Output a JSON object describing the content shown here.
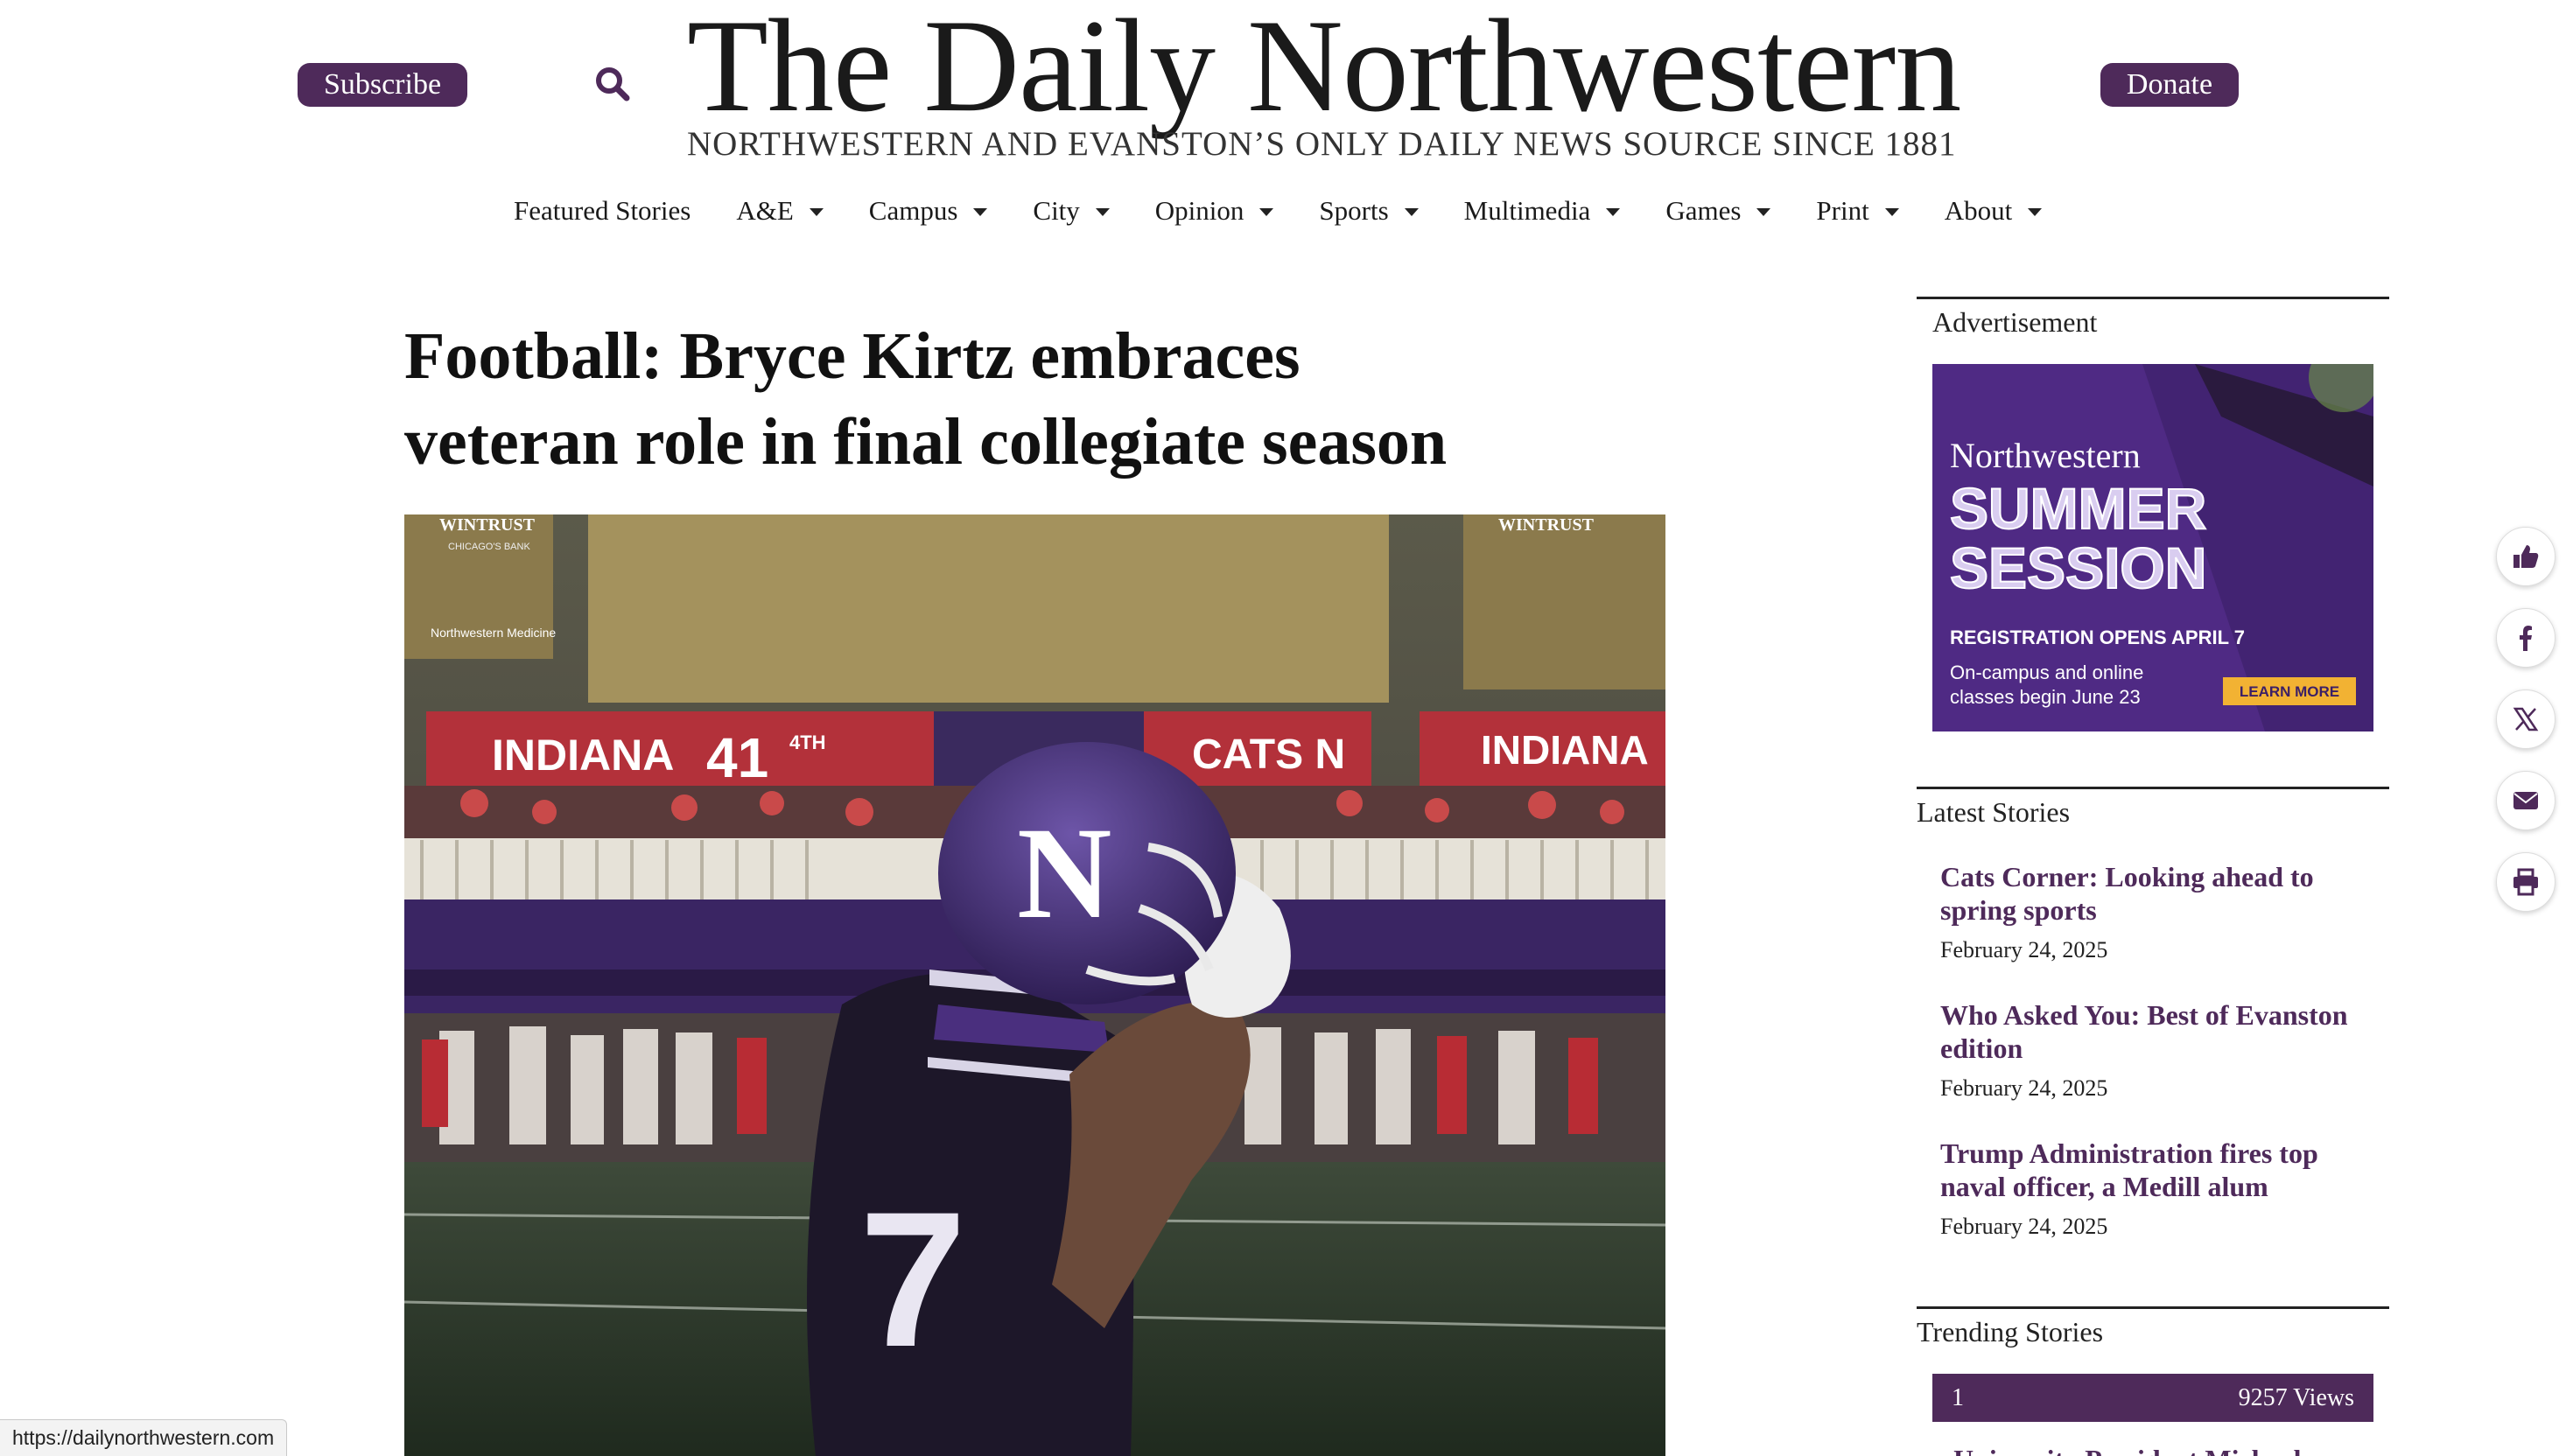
{
  "header": {
    "subscribe_label": "Subscribe",
    "donate_label": "Donate",
    "masthead": "The Daily Northwestern",
    "tagline": "NORTHWESTERN AND EVANSTON’S ONLY DAILY NEWS SOURCE SINCE 1881"
  },
  "nav": {
    "items": [
      {
        "label": "Featured Stories",
        "has_dropdown": false
      },
      {
        "label": "A&E",
        "has_dropdown": true
      },
      {
        "label": "Campus",
        "has_dropdown": true
      },
      {
        "label": "City",
        "has_dropdown": true
      },
      {
        "label": "Opinion",
        "has_dropdown": true
      },
      {
        "label": "Sports",
        "has_dropdown": true
      },
      {
        "label": "Multimedia",
        "has_dropdown": true
      },
      {
        "label": "Games",
        "has_dropdown": true
      },
      {
        "label": "Print",
        "has_dropdown": true
      },
      {
        "label": "About",
        "has_dropdown": true
      }
    ]
  },
  "article": {
    "headline_line1": "Football: Bryce Kirtz embraces",
    "headline_line2": "veteran role in final collegiate season",
    "hero": {
      "scoreboard_left_team": "INDIANA",
      "scoreboard_score": "41",
      "scoreboard_quarter": "4TH",
      "scoreboard_cats": "CATS N",
      "scoreboard_right_team": "INDIANA",
      "sponsor_left": "WINTRUST",
      "sponsor_left_sub": "CHICAGO'S BANK",
      "sponsor_nm": "Northwestern Medicine",
      "helmet_letter": "N",
      "jersey_number": "7"
    }
  },
  "sidebar": {
    "advertisement_label": "Advertisement",
    "ad": {
      "brand": "Northwestern",
      "line1": "SUMMER",
      "line2": "SESSION",
      "registration": "REGISTRATION OPENS APRIL 7",
      "detail_line1": "On-campus and online",
      "detail_line2": "classes begin June 23",
      "cta": "LEARN MORE"
    },
    "latest_heading": "Latest Stories",
    "latest": [
      {
        "title": "Cats Corner: Looking ahead to spring sports",
        "date": "February 24, 2025"
      },
      {
        "title": "Who Asked You: Best of Evanston edition",
        "date": "February 24, 2025"
      },
      {
        "title": "Trump Administration fires top naval officer, a Medill alum",
        "date": "February 24, 2025"
      }
    ],
    "trending_heading": "Trending Stories",
    "trending_first": {
      "rank": "1",
      "views": "9257 Views",
      "title_partial": "University President Michael"
    }
  },
  "share": {
    "buttons": [
      "like-icon",
      "facebook-icon",
      "x-icon",
      "email-icon",
      "print-icon"
    ]
  },
  "status_bar": {
    "url": "https://dailynorthwestern.com"
  },
  "colors": {
    "brand_purple": "#4e2a5a",
    "ad_purple": "#4f2a84"
  }
}
